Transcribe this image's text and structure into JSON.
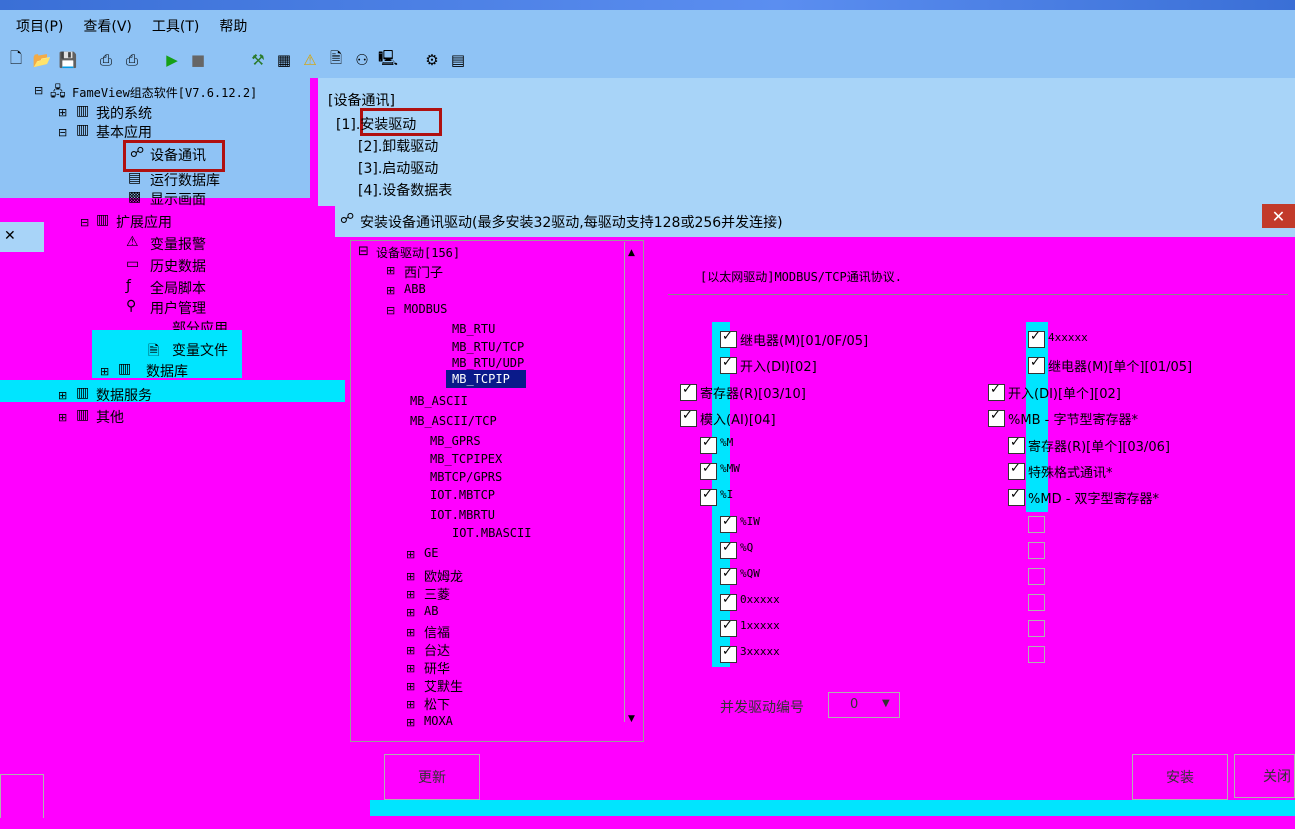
{
  "menu": [
    "项目(P)",
    "查看(V)",
    "工具(T)",
    "帮助"
  ],
  "tree": {
    "root": "FameView组态软件[V7.6.12.2]",
    "my_system": "我的系统",
    "base_app": "基本应用",
    "device_comm": "设备通讯",
    "runtime_db": "运行数据库",
    "display": "显示画面",
    "ext_app": "扩展应用",
    "alarm": "变量报警",
    "history": "历史数据",
    "script": "全局脚本",
    "user_mgmt": "用户管理",
    "partial_app": "部分应用",
    "var_file": "变量文件",
    "database": "数据库",
    "data_service": "数据服务",
    "others": "其他"
  },
  "device_panel": {
    "title": "[设备通讯]",
    "items": [
      "[1].安装驱动",
      "[2].卸载驱动",
      "[3].启动驱动",
      "[4].设备数据表"
    ]
  },
  "dialog": {
    "title": "安装设备通讯驱动(最多安装32驱动,每驱动支持128或256并发连接)",
    "protocol": "[以太网驱动]MODBUS/TCP通讯协议.",
    "tree_root": "设备驱动[156]",
    "vendors_top": [
      "西门子",
      "ABB",
      "MODBUS"
    ],
    "modbus_children": [
      "MB_RTU",
      "MB_RTU/TCP",
      "MB_RTU/UDP",
      "MB_TCPIP",
      "MB_ASCII",
      "MB_ASCII/TCP",
      "MB_GPRS",
      "MB_TCPIPEX",
      "MBTCP/GPRS",
      "IOT.MBTCP",
      "IOT.MBRTU",
      "IOT.MBASCII"
    ],
    "vendors_bottom": [
      "GE",
      "欧姆龙",
      "三菱",
      "AB",
      "信福",
      "台达",
      "研华",
      "艾默生",
      "松下",
      "MOXA"
    ],
    "left_checks": [
      "继电器(M)[01/0F/05]",
      "开入(DI)[02]",
      "寄存器(R)[03/10]",
      "模入(AI)[04]",
      "%M",
      "%MW",
      "%I",
      "%IW",
      "%Q",
      "%QW",
      "0xxxxx",
      "1xxxxx",
      "3xxxxx"
    ],
    "right_checks": [
      "4xxxxx",
      "继电器(M)[单个][01/05]",
      "开入(DI)[单个][02]",
      "%MB - 字节型寄存器*",
      "寄存器(R)[单个][03/06]",
      "特殊格式通讯*",
      "%MD - 双字型寄存器*"
    ],
    "concurrent_label": "并发驱动编号",
    "concurrent_value": "0",
    "update_btn": "更新",
    "install_btn": "安装",
    "close_btn": "关闭"
  },
  "colors": {
    "glitch_magenta": "#ff00ff",
    "glitch_cyan": "#00e5ff",
    "panel_blue": "#8fc3f5",
    "selection_red": "#b01010"
  }
}
